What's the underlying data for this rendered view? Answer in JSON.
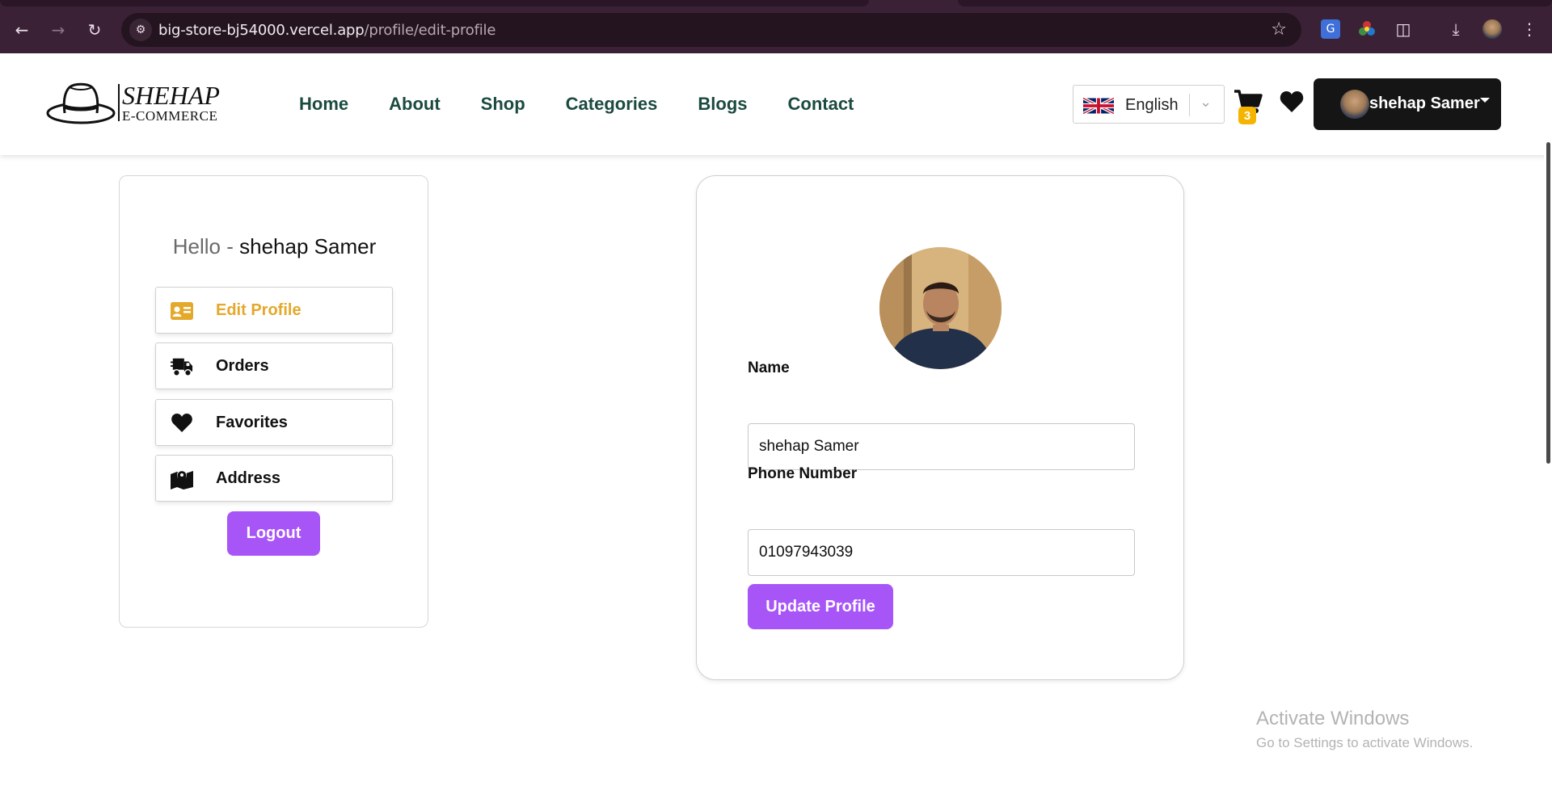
{
  "browser": {
    "url_host": "big-store-bj54000.vercel.app",
    "url_path": "/profile/edit-profile",
    "icons": {
      "back": "back-arrow-icon",
      "forward": "forward-arrow-icon",
      "reload": "reload-icon",
      "site_info": "site-settings-icon",
      "bookmark": "star-icon",
      "extensions": [
        "google-translate-icon",
        "color-wheel-icon",
        "puzzle-icon"
      ],
      "download": "download-icon",
      "menu": "kebab-menu-icon"
    }
  },
  "header": {
    "logo": {
      "name": "SHEHAP",
      "sub": "E-COMMERCE"
    },
    "nav": [
      "Home",
      "About",
      "Shop",
      "Categories",
      "Blogs",
      "Contact"
    ],
    "language": "English",
    "cart_count": "3",
    "user_name": "shehap Samer"
  },
  "sidebar": {
    "hello_prefix": "Hello - ",
    "hello_name": "shehap Samer",
    "items": [
      {
        "label": "Edit Profile",
        "icon": "id-card-icon",
        "active": true
      },
      {
        "label": "Orders",
        "icon": "truck-icon",
        "active": false
      },
      {
        "label": "Favorites",
        "icon": "heart-icon",
        "active": false
      },
      {
        "label": "Address",
        "icon": "map-marker-icon",
        "active": false
      }
    ],
    "logout_label": "Logout"
  },
  "form": {
    "name_label": "Name",
    "name_value": "shehap Samer",
    "phone_label": "Phone Number",
    "phone_value": "01097943039",
    "submit_label": "Update Profile"
  },
  "watermark": {
    "title": "Activate Windows",
    "subtitle": "Go to Settings to activate Windows."
  },
  "colors": {
    "chrome_bg": "#3b2136",
    "nav_text": "#1b4a3f",
    "accent_purple": "#a855f7",
    "active_gold": "#e4a82a",
    "badge": "#f5b400",
    "user_button": "#151515"
  }
}
